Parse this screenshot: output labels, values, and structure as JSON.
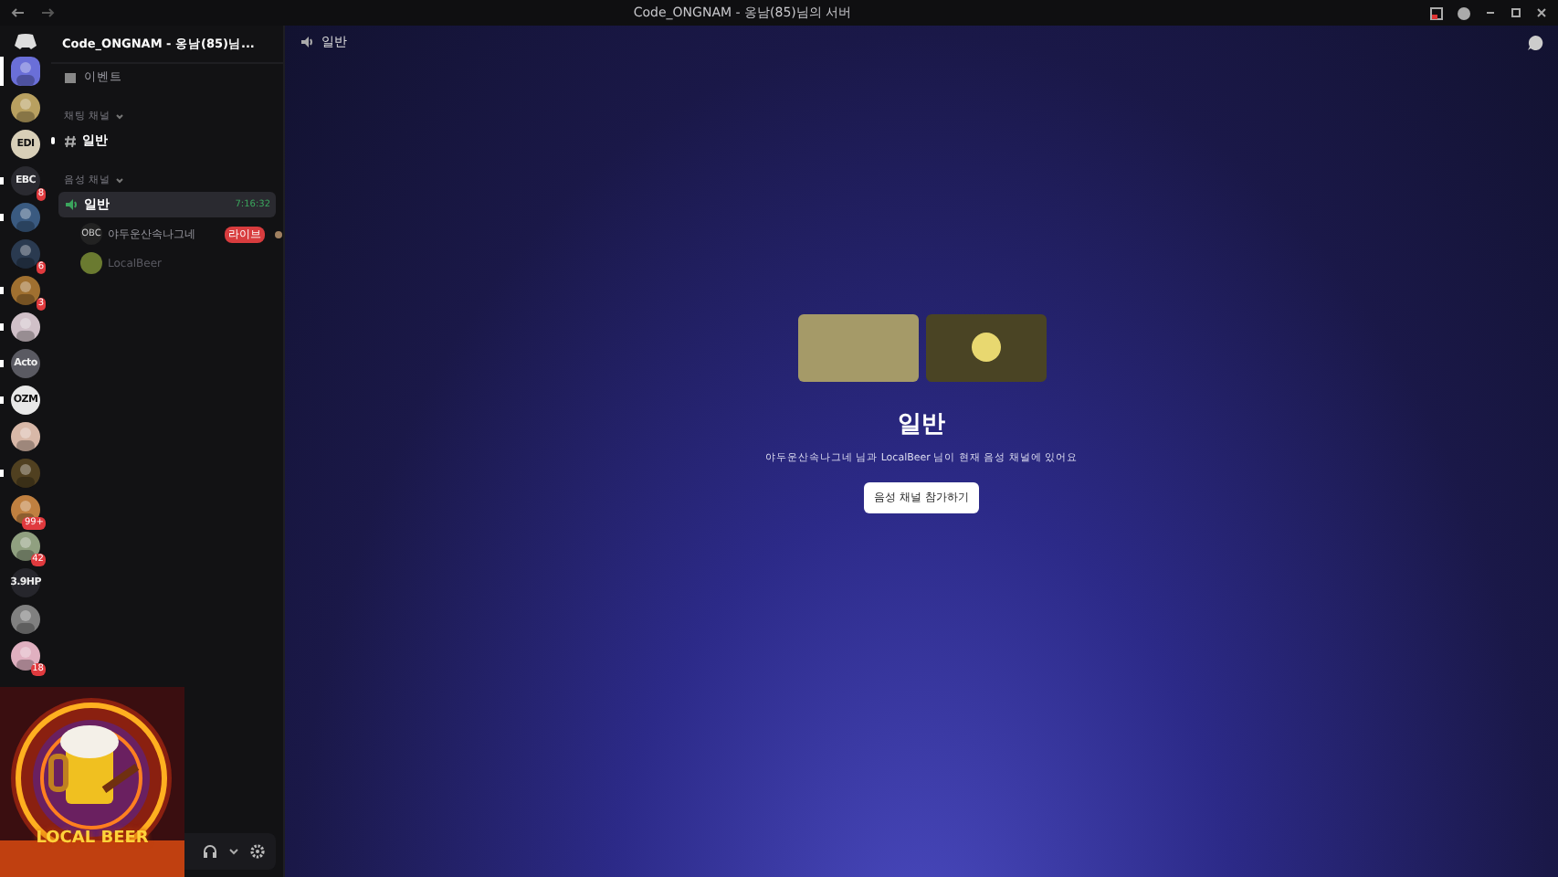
{
  "window": {
    "title": "Code_ONGNAM - 옹남(85)님의 서버"
  },
  "servers": [
    {
      "kind": "picture",
      "color": "#6a6fd8",
      "unread": false,
      "selected": true
    },
    {
      "kind": "picture",
      "color": "#b8a060",
      "unread": false,
      "selected": false
    },
    {
      "kind": "text",
      "label": "EDI",
      "color": "#d8cfb8",
      "unread": false,
      "selected": false
    },
    {
      "kind": "text",
      "label": "EBC",
      "color": "#2a2a30",
      "unread": true,
      "selected": false,
      "badge": "8"
    },
    {
      "kind": "picture",
      "color": "#3a5a80",
      "unread": true,
      "selected": false
    },
    {
      "kind": "picture",
      "color": "#2a3a50",
      "unread": false,
      "selected": false,
      "badge": "6"
    },
    {
      "kind": "picture",
      "color": "#a07030",
      "unread": true,
      "selected": false,
      "badge": "3"
    },
    {
      "kind": "picture",
      "color": "#d0c0c8",
      "unread": true,
      "selected": false
    },
    {
      "kind": "text",
      "label": "Acto",
      "color": "#5a5a62",
      "unread": true,
      "selected": false
    },
    {
      "kind": "text",
      "label": "OZM",
      "color": "#e8e8e8",
      "unread": true,
      "selected": false
    },
    {
      "kind": "picture",
      "color": "#d8b8a8",
      "unread": false,
      "selected": false
    },
    {
      "kind": "picture",
      "color": "#504020",
      "unread": true,
      "selected": false
    },
    {
      "kind": "picture",
      "color": "#c08040",
      "unread": false,
      "selected": false,
      "badge": "99+"
    },
    {
      "kind": "picture",
      "color": "#90a080",
      "unread": false,
      "selected": false,
      "badge": "42"
    },
    {
      "kind": "text",
      "label": "3.9HP",
      "color": "#26262c",
      "unread": false,
      "selected": false
    },
    {
      "kind": "picture",
      "color": "#808080",
      "unread": false,
      "selected": false
    },
    {
      "kind": "picture",
      "color": "#e0b0c0",
      "unread": false,
      "selected": false,
      "badge": "18"
    }
  ],
  "server_header": {
    "name": "Code_ONGNAM - 옹남(85)님..."
  },
  "events": {
    "label": "이벤트"
  },
  "categories": [
    {
      "name": "채팅 채널",
      "expanded": true,
      "channels": [
        {
          "kind": "text",
          "name": "일반",
          "unread": true,
          "selected": false
        }
      ]
    },
    {
      "name": "음성 채널",
      "expanded": true,
      "channels": [
        {
          "kind": "voice",
          "name": "일반",
          "unread": false,
          "selected": true,
          "time": "7:16:32",
          "members": [
            {
              "name": "야두운산속나그네",
              "avatar": "OBC",
              "live": "라이브",
              "muted": false
            },
            {
              "name": "LocalBeer",
              "muted": true
            }
          ]
        }
      ]
    }
  ],
  "topbar": {
    "channel": "일반"
  },
  "stage": {
    "title": "일반",
    "subtitle": "야두운산속나그네 님과 LocalBeer 님이 현재 음성 채널에 있어요",
    "button": "음성 채널 참가하기"
  },
  "overlay": {
    "logo": "LOCAL BEER"
  }
}
